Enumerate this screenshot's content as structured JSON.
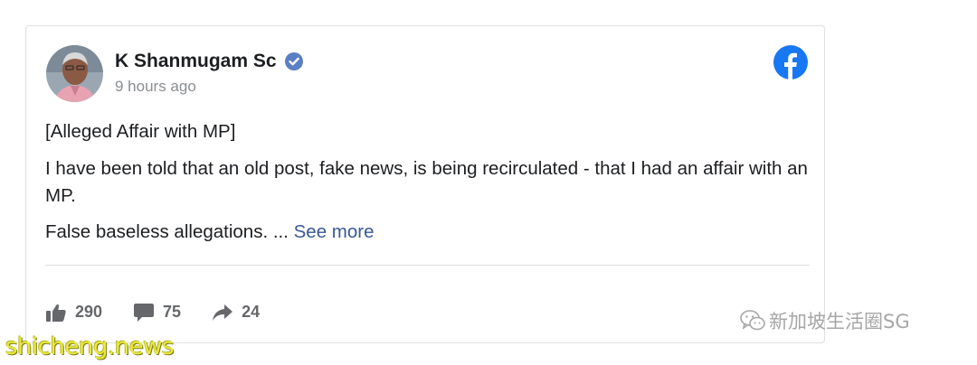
{
  "post": {
    "author": "K Shanmugam Sc",
    "time": "9 hours ago",
    "heading": "[Alleged Affair with MP]",
    "paragraph": "I have been told that an old post, fake news, is being recirculated - that I had an affair with an MP.",
    "excerpt": "False baseless allegations. ... ",
    "see_more": "See more"
  },
  "reactions": {
    "likes": "290",
    "comments": "75",
    "shares": "24"
  },
  "icons": {
    "verified": "verified-badge-icon",
    "platform": "facebook-logo-icon",
    "like": "thumbs-up-icon",
    "comment": "comment-icon",
    "share": "share-arrow-icon",
    "wechat": "wechat-icon"
  },
  "watermarks": {
    "channel": "新加坡生活圈SG",
    "site": "shicheng.news"
  },
  "colors": {
    "facebook_blue": "#1877f2",
    "link": "#385898",
    "muted": "#65676b",
    "site_watermark": "#e9e93a"
  }
}
